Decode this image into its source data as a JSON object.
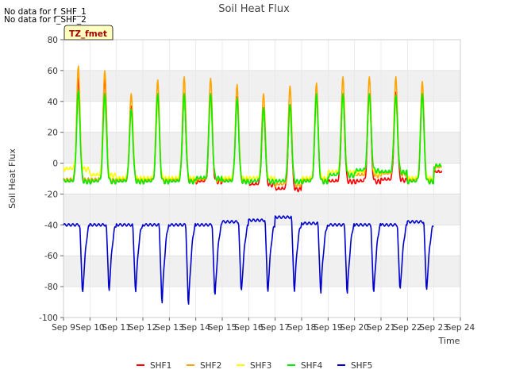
{
  "notes": [
    "No data for f_SHF_1",
    "No data for f_SHF_2"
  ],
  "badge": "TZ_fmet",
  "chart_data": {
    "type": "line",
    "title": "Soil Heat Flux",
    "xlabel": "Time",
    "ylabel": "Soil Heat Flux",
    "ylim": [
      -100,
      80
    ],
    "yticks": [
      -100,
      -80,
      -60,
      -40,
      -20,
      0,
      20,
      40,
      60,
      80
    ],
    "xlim": [
      9,
      24
    ],
    "xticks": [
      9,
      10,
      11,
      12,
      13,
      14,
      15,
      16,
      17,
      18,
      19,
      20,
      21,
      22,
      23,
      24
    ],
    "xtick_labels": [
      "Sep 9",
      "Sep 10",
      "Sep 11",
      "Sep 12",
      "Sep 13",
      "Sep 14",
      "Sep 15",
      "Sep 16",
      "Sep 17",
      "Sep 18",
      "Sep 19",
      "Sep 20",
      "Sep 21",
      "Sep 22",
      "Sep 23",
      "Sep 24"
    ],
    "grid": true,
    "legend_position": "bottom",
    "day_start": 9,
    "days": 15,
    "series": [
      {
        "name": "SHF1",
        "color": "#ff0000",
        "min": [
          -12,
          -12,
          -12,
          -12,
          -12,
          -12,
          -12,
          -14,
          -17,
          -12,
          -12,
          -12,
          -11,
          -12,
          -6
        ],
        "max": [
          55,
          56,
          37,
          44,
          42,
          45,
          43,
          34,
          37,
          44,
          44,
          44,
          46,
          44
        ]
      },
      {
        "name": "SHF2",
        "color": "#ffa500",
        "min": [
          -11,
          -11,
          -11,
          -11,
          -11,
          -11,
          -11,
          -12,
          -14,
          -11,
          -8,
          -8,
          -7,
          -11,
          -3
        ],
        "max": [
          63,
          60,
          45,
          54,
          56,
          55,
          51,
          45,
          50,
          52,
          56,
          56,
          56,
          53
        ]
      },
      {
        "name": "SHF3",
        "color": "#ffff00",
        "min": [
          -4,
          -8,
          -10,
          -10,
          -10,
          -10,
          -10,
          -10,
          -12,
          -10,
          -6,
          -6,
          -6,
          -10,
          -2
        ],
        "max": [
          42,
          40,
          33,
          40,
          42,
          42,
          40,
          33,
          35,
          42,
          42,
          42,
          42,
          42
        ]
      },
      {
        "name": "SHF4",
        "color": "#00ee00",
        "min": [
          -12,
          -12,
          -12,
          -12,
          -12,
          -10,
          -12,
          -12,
          -12,
          -12,
          -8,
          -5,
          -6,
          -12,
          -2
        ],
        "max": [
          47,
          45,
          35,
          45,
          45,
          45,
          42,
          36,
          38,
          45,
          45,
          45,
          44,
          45
        ]
      },
      {
        "name": "SHF5",
        "color": "#0000cc",
        "base": -40,
        "min": [
          -87,
          -85,
          -85,
          -93,
          -95,
          -89,
          -86,
          -86,
          -85,
          -86,
          -87,
          -87,
          -85,
          -85
        ],
        "pre": [
          -40,
          -40,
          -40,
          -40,
          -40,
          -40,
          -38,
          -37,
          -35,
          -39,
          -40,
          -40,
          -40,
          -38
        ]
      }
    ]
  }
}
